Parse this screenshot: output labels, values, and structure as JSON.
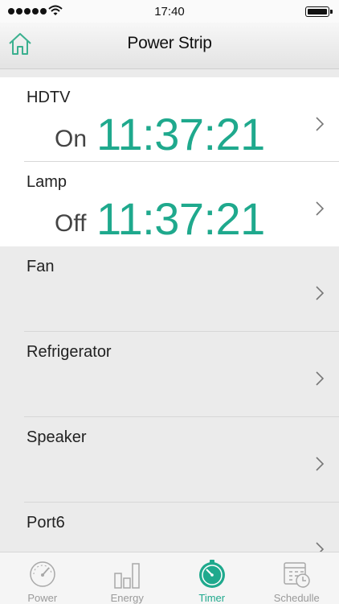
{
  "status": {
    "time": "17:40"
  },
  "nav": {
    "title": "Power Strip"
  },
  "ports": [
    {
      "name": "HDTV",
      "state": "On",
      "time": "11:37:21"
    },
    {
      "name": "Lamp",
      "state": "Off",
      "time": "11:37:21"
    },
    {
      "name": "Fan"
    },
    {
      "name": "Refrigerator"
    },
    {
      "name": "Speaker"
    },
    {
      "name": "Port6"
    }
  ],
  "tabs": [
    {
      "label": "Power",
      "icon": "gauge-icon"
    },
    {
      "label": "Energy",
      "icon": "bar-chart-icon"
    },
    {
      "label": "Timer",
      "icon": "timer-icon"
    },
    {
      "label": "Schedulle",
      "icon": "calendar-clock-icon"
    }
  ],
  "colors": {
    "accent": "#1fa98d",
    "home_icon": "#3bb08f"
  }
}
